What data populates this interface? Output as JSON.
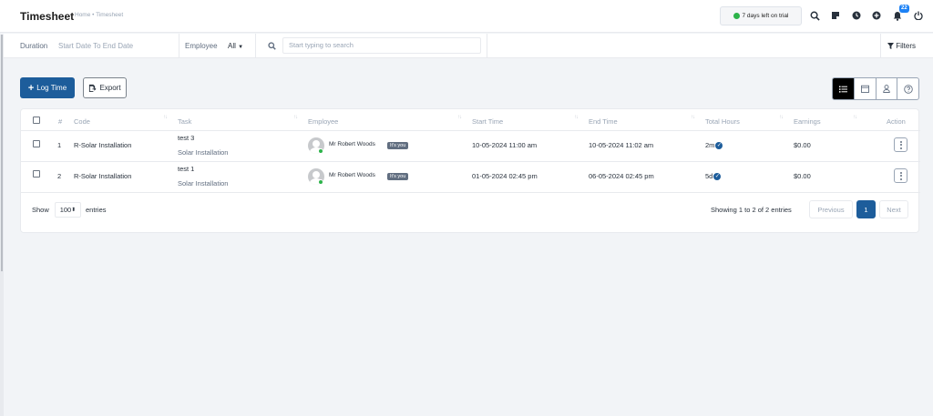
{
  "header": {
    "title": "Timesheet",
    "breadcrumb": "Home • Timesheet",
    "trial_text": "7 days left on trial",
    "notification_count": "22"
  },
  "filters": {
    "duration_label": "Duration",
    "duration_value": "Start Date To End Date",
    "employee_label": "Employee",
    "employee_value": "All",
    "search_placeholder": "Start typing to search",
    "filters_label": "Filters"
  },
  "actions": {
    "log_time_label": "Log Time",
    "export_label": "Export"
  },
  "table": {
    "columns": {
      "num": "#",
      "code": "Code",
      "task": "Task",
      "employee": "Employee",
      "start": "Start Time",
      "end": "End Time",
      "hours": "Total Hours",
      "earnings": "Earnings",
      "action": "Action"
    },
    "rows": [
      {
        "num": "1",
        "code": "R-Solar Installation",
        "task": "test 3",
        "project": "Solar Installation",
        "employee": "Mr Robert Woods",
        "badge": "It's you",
        "start": "10-05-2024 11:00 am",
        "end": "10-05-2024 11:02 am",
        "hours": "2m",
        "earnings": "$0.00"
      },
      {
        "num": "2",
        "code": "R-Solar Installation",
        "task": "test 1",
        "project": "Solar Installation",
        "employee": "Mr Robert Woods",
        "badge": "It's you",
        "start": "01-05-2024 02:45 pm",
        "end": "06-05-2024 02:45 pm",
        "hours": "5d",
        "earnings": "$0.00"
      }
    ]
  },
  "footer": {
    "show_label": "Show",
    "page_size": "100",
    "entries_label": "entries",
    "info": "Showing 1 to 2 of 2 entries",
    "previous": "Previous",
    "current_page": "1",
    "next": "Next"
  },
  "colors": {
    "primary": "#1d5d9b",
    "online": "#2db34a",
    "notification": "#1d82f5"
  }
}
